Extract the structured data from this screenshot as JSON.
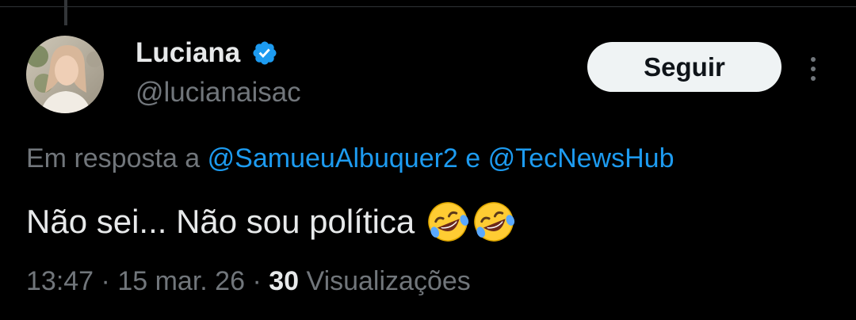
{
  "author": {
    "name": "Luciana",
    "handle": "@lucianaisac",
    "verified_color": "#1d9bf0"
  },
  "follow_button": {
    "label": "Seguir"
  },
  "more_menu": {
    "icon": "more-vertical-icon"
  },
  "reply_context": {
    "prefix": "Em resposta a",
    "mention_1": "@SamueuAlbuquer2",
    "conjunction": "e",
    "mention_2": "@TecNewsHub"
  },
  "tweet": {
    "text": "Não sei... Não sou política",
    "emojis": [
      "rolling-on-floor-laughing-emoji",
      "rolling-on-floor-laughing-emoji"
    ]
  },
  "meta": {
    "time": "13:47",
    "separator": "·",
    "date": "15 mar. 26",
    "views_count": "30",
    "views_label": "Visualizações"
  },
  "colors": {
    "background": "#000000",
    "text_primary": "#e7e9ea",
    "text_secondary": "#71767b",
    "link": "#1d9bf0",
    "button_bg": "#eff3f4"
  }
}
